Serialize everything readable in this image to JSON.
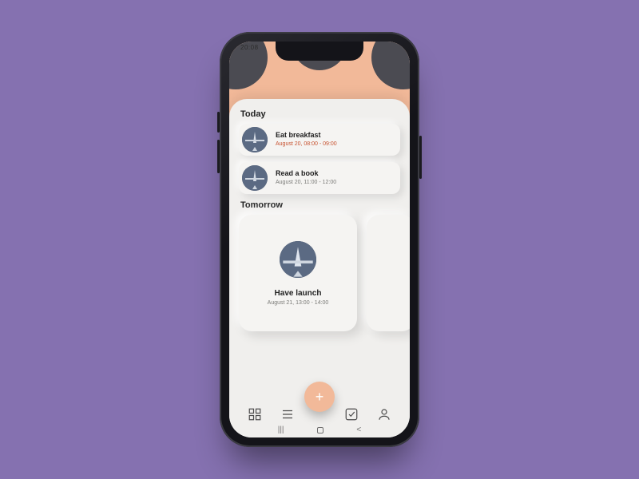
{
  "statusbar": {
    "time": "20:08"
  },
  "sections": {
    "today": {
      "title": "Today",
      "tasks": [
        {
          "title": "Eat breakfast",
          "meta": "August 20,  08:00 - 09:00",
          "highlight": true
        },
        {
          "title": "Read a book",
          "meta": "August 20,  11:00 - 12:00",
          "highlight": false
        }
      ]
    },
    "tomorrow": {
      "title": "Tomorrow",
      "cards": [
        {
          "title": "Have launch",
          "meta": "August 21, 13:00 - 14:00"
        }
      ]
    }
  },
  "fab": {
    "plus": "+"
  },
  "icons": {
    "thumb_name": "airplane-photo"
  }
}
